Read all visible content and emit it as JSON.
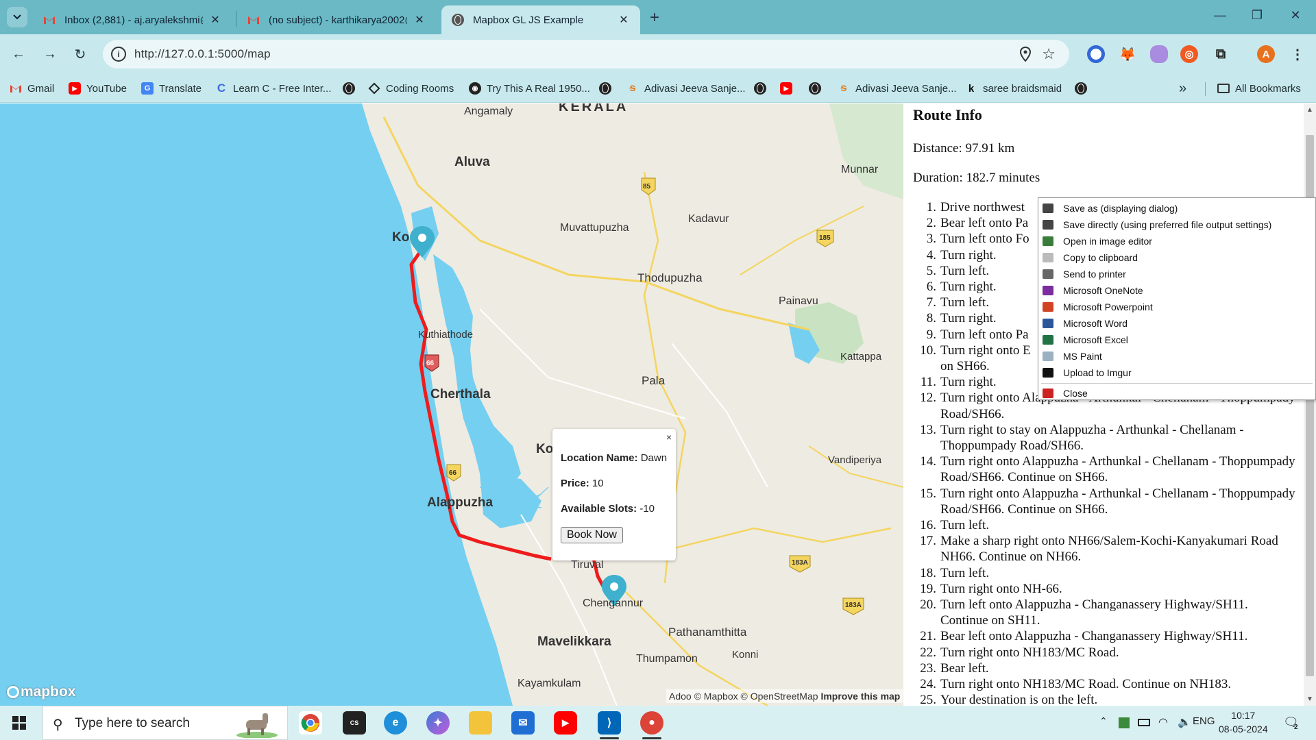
{
  "browser": {
    "tabs": [
      {
        "title": "Inbox (2,881) - aj.aryalekshmi@",
        "icon": "gmail-icon"
      },
      {
        "title": "(no subject) - karthikarya2002@",
        "icon": "gmail-icon"
      },
      {
        "title": "Mapbox GL JS Example",
        "icon": "globe-icon"
      }
    ],
    "new_tab": "+",
    "close": "✕",
    "url": "http://127.0.0.1:5000/map",
    "profile_initial": "A"
  },
  "bookmarks": [
    {
      "label": "Gmail",
      "icon": "gmail-icon"
    },
    {
      "label": "YouTube",
      "icon": "youtube-icon"
    },
    {
      "label": "Translate",
      "icon": "translate-icon"
    },
    {
      "label": "Learn C - Free Inter...",
      "icon": "learn-c-icon"
    },
    {
      "label": "",
      "icon": "globe-icon"
    },
    {
      "label": "Coding Rooms",
      "icon": "coding-rooms-icon"
    },
    {
      "label": "Try This A Real 1950...",
      "icon": "eye-icon"
    },
    {
      "label": "",
      "icon": "globe-icon"
    },
    {
      "label": "Adivasi Jeeva Sanje...",
      "icon": "adivasi-icon"
    },
    {
      "label": "",
      "icon": "globe-icon"
    },
    {
      "label": "",
      "icon": "youtube-icon"
    },
    {
      "label": "",
      "icon": "globe-icon"
    },
    {
      "label": "Adivasi Jeeva Sanje...",
      "icon": "adivasi-icon"
    },
    {
      "label": "saree braidsmaid",
      "icon": "k-icon"
    },
    {
      "label": "",
      "icon": "globe-icon"
    }
  ],
  "bookmarks_more": "»",
  "all_bookmarks": "All Bookmarks",
  "map": {
    "labels": {
      "kerala": "KERALA",
      "angamaly": "Angamaly",
      "aluva": "Aluva",
      "munnar": "Munnar",
      "kochi": "Ko",
      "muvattupuzha": "Muvattupuzha",
      "kadavur": "Kadavur",
      "thodupuzha": "Thodupuzha",
      "painavu": "Painavu",
      "kuthiathode": "Kuthiathode",
      "kattappana": "Kattappa",
      "cherthala": "Cherthala",
      "pala": "Pala",
      "kottayam": "Kot",
      "vandiperiyar": "Vandiperiya",
      "alappuzha": "Alappuzha",
      "tiruvalla": "Tiruval",
      "chengannur": "Chengannur",
      "pathanamthitta": "Pathanamthitta",
      "mavelikkara": "Mavelikkara",
      "konni": "Konni",
      "thumpamon": "Thumpamon",
      "kayamkulam": "Kayamkulam",
      "adoor": "Adoo",
      "shield_85": "85",
      "shield_185": "185",
      "shield_66a": "66",
      "shield_66b": "66",
      "shield_183a1": "183A",
      "shield_183a2": "183A"
    },
    "logo": "mapbox",
    "attribution": "© Mapbox © OpenStreetMap",
    "improve": "Improve this map",
    "route_color": "#ee1c1c",
    "water_color": "#75cff0",
    "marker_color": "#3fb1ce"
  },
  "popup": {
    "close": "×",
    "location_label": "Location Name:",
    "location_value": "Dawn",
    "price_label": "Price:",
    "price_value": "10",
    "slots_label": "Available Slots:",
    "slots_value": "-10",
    "book_button": "Book Now"
  },
  "route": {
    "title": "Route Info",
    "distance": "Distance: 97.91 km",
    "duration": "Duration: 182.7 minutes",
    "steps": [
      "Drive northwest",
      "Bear left onto Pa",
      "Turn left onto Fo",
      "Turn right.",
      "Turn left.",
      "Turn right.",
      "Turn left.",
      "Turn right.",
      "Turn left onto Pa",
      "Turn right onto E",
      "Turn right.",
      "Turn right onto Alappuzha - Arthunkal - Chellanam - Thoppumpady Road/SH66.",
      "Turn right to stay on Alappuzha - Arthunkal - Chellanam - Thoppumpady Road/SH66.",
      "Turn right onto Alappuzha - Arthunkal - Chellanam - Thoppumpady Road/SH66. Continue on SH66.",
      "Turn right onto Alappuzha - Arthunkal - Chellanam - Thoppumpady Road/SH66. Continue on SH66.",
      "Turn left.",
      "Make a sharp right onto NH66/Salem-Kochi-Kanyakumari Road NH66. Continue on NH66.",
      "Turn left.",
      "Turn right onto NH-66.",
      "Turn left onto Alappuzha - Changanassery Highway/SH11. Continue on SH11.",
      "Bear left onto Alappuzha - Changanassery Highway/SH11.",
      "Turn right onto NH183/MC Road.",
      "Bear left.",
      "Turn right onto NH183/MC Road. Continue on NH183.",
      "Your destination is on the left."
    ],
    "step10_cont": "on SH66."
  },
  "context_menu": [
    {
      "label": "Save as (displaying dialog)",
      "icon": "floppy-icon",
      "color": "#444444"
    },
    {
      "label": "Save directly (using preferred file output settings)",
      "icon": "floppy-icon",
      "color": "#444444"
    },
    {
      "label": "Open in image editor",
      "icon": "image-editor-icon",
      "color": "#3a7d3a"
    },
    {
      "label": "Copy to clipboard",
      "icon": "clipboard-icon",
      "color": "#bbbbbb"
    },
    {
      "label": "Send to printer",
      "icon": "printer-icon",
      "color": "#666666"
    },
    {
      "label": "Microsoft OneNote",
      "icon": "onenote-icon",
      "color": "#7b2c9e"
    },
    {
      "label": "Microsoft Powerpoint",
      "icon": "powerpoint-icon",
      "color": "#d04423"
    },
    {
      "label": "Microsoft Word",
      "icon": "word-icon",
      "color": "#2b579a"
    },
    {
      "label": "Microsoft Excel",
      "icon": "excel-icon",
      "color": "#217346"
    },
    {
      "label": "MS Paint",
      "icon": "paint-icon",
      "color": "#9bb0c0"
    },
    {
      "label": "Upload to Imgur",
      "icon": "imgur-icon",
      "color": "#111111"
    },
    {
      "label": "Close",
      "icon": "close-icon",
      "color": "#cc2222"
    }
  ],
  "taskbar": {
    "search_placeholder": "Type here to search",
    "language": "ENG",
    "time": "10:17",
    "date": "08-05-2024",
    "notifications": "2",
    "apps": [
      "chrome-icon",
      "cybersky-icon",
      "edge-icon",
      "copilot-icon",
      "file-explorer-icon",
      "mail-icon",
      "youtube-icon",
      "vscode-icon",
      "chrome-profile-icon"
    ]
  }
}
